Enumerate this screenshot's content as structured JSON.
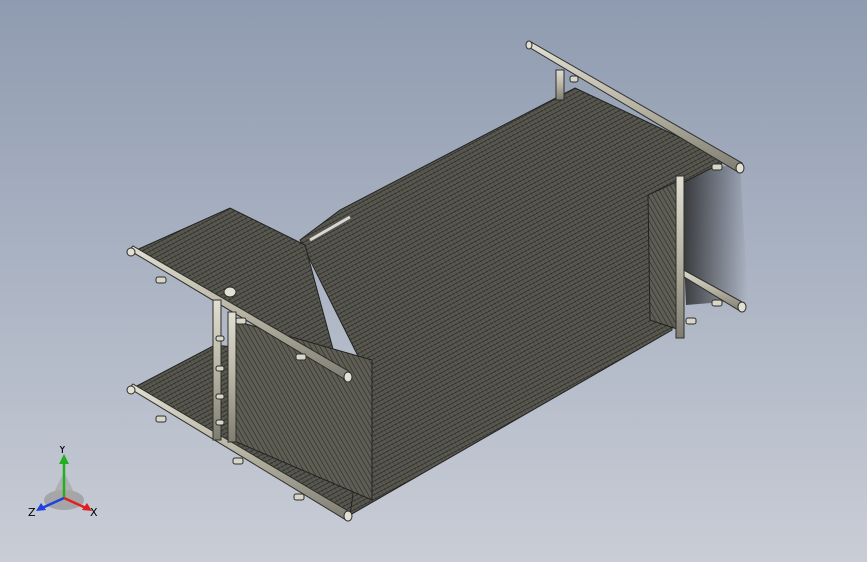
{
  "viewport": {
    "background_top": "#8f9bb0",
    "background_bottom": "#c9cdd6",
    "model": {
      "mesh_color": "#3a3a35",
      "frame_color": "#b9b6a8",
      "frame_edge": "#2e2e2a"
    }
  },
  "triad": {
    "x_label": "X",
    "y_label": "Y",
    "z_label": "Z",
    "x_color": "#e02020",
    "y_color": "#20b020",
    "z_color": "#2040e0"
  }
}
